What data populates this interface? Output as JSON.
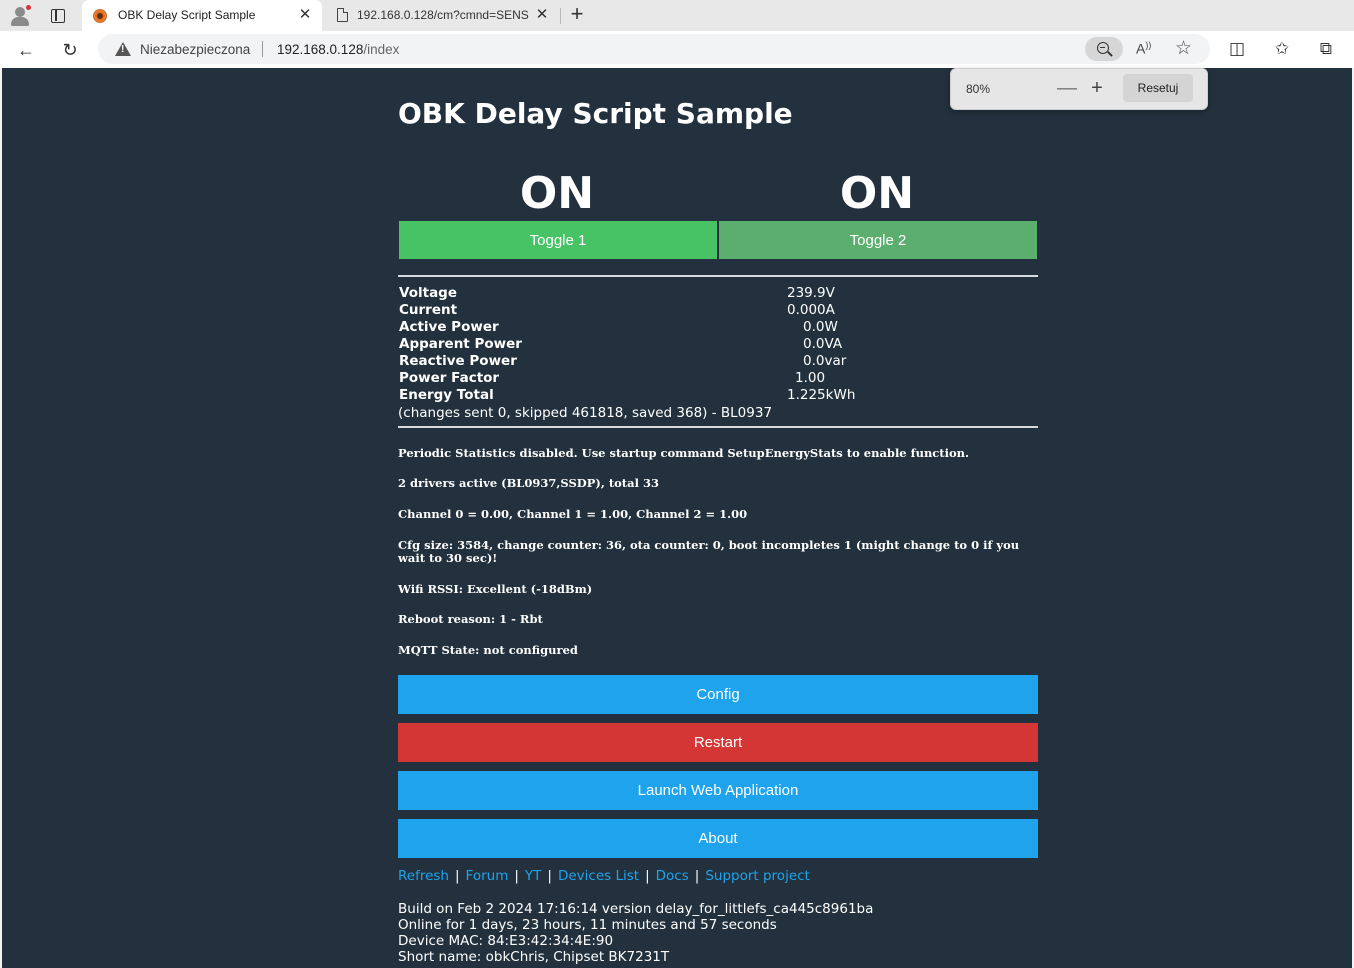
{
  "browser": {
    "tabs": [
      {
        "title": "OBK Delay Script Sample",
        "active": true
      },
      {
        "title": "192.168.0.128/cm?cmnd=SENSOR",
        "active": false
      }
    ],
    "address": {
      "security_label": "Niezabezpieczona",
      "host": "192.168.0.128",
      "path": "/index"
    },
    "zoom_popup": {
      "level": "80%",
      "minus": "—",
      "plus": "+",
      "reset_label": "Resetuj"
    },
    "icons": {
      "back": "back-arrow-icon",
      "refresh": "refresh-icon",
      "zoom": "magnifier-icon",
      "read_aloud": "read-aloud-icon",
      "favorite": "star-icon",
      "split": "split-screen-icon",
      "favorites": "favorites-icon",
      "collections": "collections-icon"
    }
  },
  "page": {
    "title": "OBK Delay Script Sample",
    "channels": [
      {
        "state": "ON",
        "toggle_label": "Toggle 1"
      },
      {
        "state": "ON",
        "toggle_label": "Toggle 2"
      }
    ],
    "measurements": [
      {
        "label": "Voltage",
        "value": "239.9V"
      },
      {
        "label": "Current",
        "value": "0.000A"
      },
      {
        "label": "Active Power",
        "value": "0.0W"
      },
      {
        "label": "Apparent Power",
        "value": "0.0VA"
      },
      {
        "label": "Reactive Power",
        "value": "0.0var"
      },
      {
        "label": "Power Factor",
        "value": "1.00"
      },
      {
        "label": "Energy Total",
        "value": "1.225kWh"
      }
    ],
    "changes_line": "(changes sent 0, skipped 461818, saved 368) - BL0937",
    "info_lines": [
      "Periodic Statistics disabled. Use startup command SetupEnergyStats to enable function.",
      "2 drivers active (BL0937,SSDP), total 33",
      "Channel 0 = 0.00, Channel 1 = 1.00, Channel 2 = 1.00",
      "Cfg size: 3584, change counter: 36, ota counter: 0, boot incompletes 1 (might change to 0 if you wait to 30 sec)!",
      "Wifi RSSI: Excellent (-18dBm)",
      "Reboot reason: 1 - Rbt",
      "MQTT State: not configured"
    ],
    "buttons": {
      "config": "Config",
      "restart": "Restart",
      "launch_web_app": "Launch Web Application",
      "about": "About"
    },
    "links": [
      "Refresh",
      "Forum",
      "YT",
      "Devices List",
      "Docs",
      "Support project"
    ],
    "link_separator": "|",
    "footer": [
      "Build on Feb 2 2024 17:16:14 version delay_for_littlefs_ca445c8961ba",
      "Online for 1 days, 23 hours, 11 minutes and 57 seconds",
      "Device MAC: 84:E3:42:34:4E:90",
      "Short name: obkChris, Chipset BK7231T"
    ],
    "colors": {
      "background": "#22313d",
      "toggle_on": "#47c265",
      "button_blue": "#1fa3ec",
      "button_red": "#d43535",
      "link": "#1fa3ec"
    }
  }
}
